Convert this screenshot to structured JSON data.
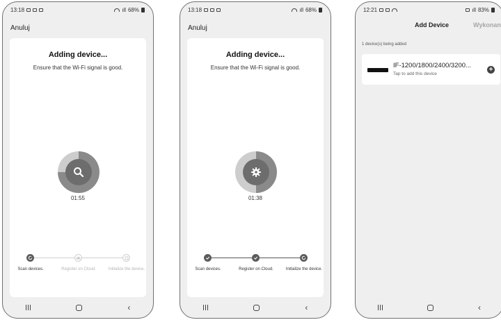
{
  "phones": [
    {
      "status": {
        "time": "13:18",
        "battery": "68%"
      },
      "cancel": "Anuluj",
      "title": "Adding device...",
      "subtitle": "Ensure that the Wi-Fi signal is good.",
      "icon": "search-icon",
      "timer": "01:55",
      "progress": 0.75,
      "steps": [
        {
          "label": "Scan devices.",
          "state": "active"
        },
        {
          "label": "Register on Cloud.",
          "state": "pending"
        },
        {
          "label": "Initialize the device.",
          "state": "pending"
        }
      ]
    },
    {
      "status": {
        "time": "13:18",
        "battery": "68%"
      },
      "cancel": "Anuluj",
      "title": "Adding device...",
      "subtitle": "Ensure that the Wi-Fi signal is good.",
      "icon": "gear-icon",
      "timer": "01:38",
      "progress": 0.5,
      "steps": [
        {
          "label": "Scan devices.",
          "state": "done"
        },
        {
          "label": "Register on Cloud.",
          "state": "done"
        },
        {
          "label": "Initialize the device.",
          "state": "active"
        }
      ]
    }
  ],
  "add_device": {
    "status": {
      "time": "12:21",
      "battery": "83%"
    },
    "title": "Add Device",
    "done": "Wykonano",
    "count": "1 device(s) being added",
    "device_name": "IF-1200/1800/2400/3200...",
    "device_hint": "Tap to add this device",
    "add_icon": "plus-circle-icon"
  },
  "colors": {
    "ring_fill": "#8a8a8a",
    "ring_track": "#cdcdcd",
    "step_active": "#5c5c5c",
    "step_pending": "#cfcfcf",
    "card_bg": "#ffffff",
    "screen_bg": "#efefef"
  }
}
